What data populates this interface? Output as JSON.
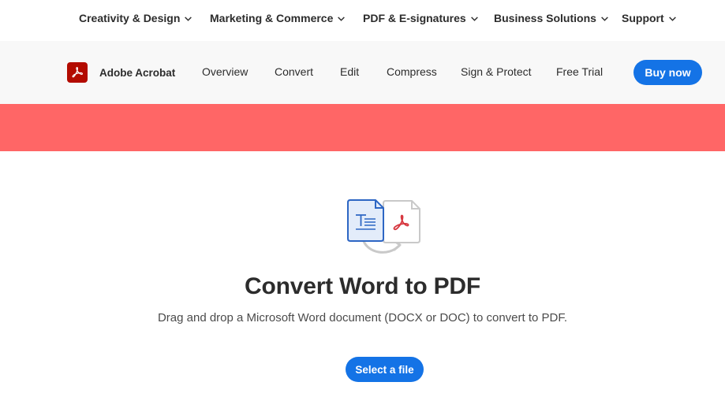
{
  "global_nav": {
    "items": [
      {
        "label": "Creativity & Design"
      },
      {
        "label": "Marketing & Commerce"
      },
      {
        "label": "PDF & E-signatures"
      },
      {
        "label": "Business Solutions"
      },
      {
        "label": "Support"
      }
    ]
  },
  "sub_nav": {
    "brand": "Adobe Acrobat",
    "links": [
      {
        "label": "Overview"
      },
      {
        "label": "Convert"
      },
      {
        "label": "Edit"
      },
      {
        "label": "Compress"
      },
      {
        "label": "Sign & Protect"
      },
      {
        "label": "Free Trial"
      }
    ],
    "buy_label": "Buy now"
  },
  "main": {
    "title": "Convert Word to PDF",
    "description": "Drag and drop a Microsoft Word document (DOCX or DOC) to convert to PDF.",
    "select_label": "Select a file"
  },
  "colors": {
    "accent": "#1473e6",
    "banner": "#ff6666",
    "acrobat_red": "#b30b00"
  },
  "icons": [
    "chevron-down-icon",
    "acrobat-logo-icon",
    "word-document-icon",
    "pdf-document-icon",
    "convert-arrow-icon"
  ]
}
